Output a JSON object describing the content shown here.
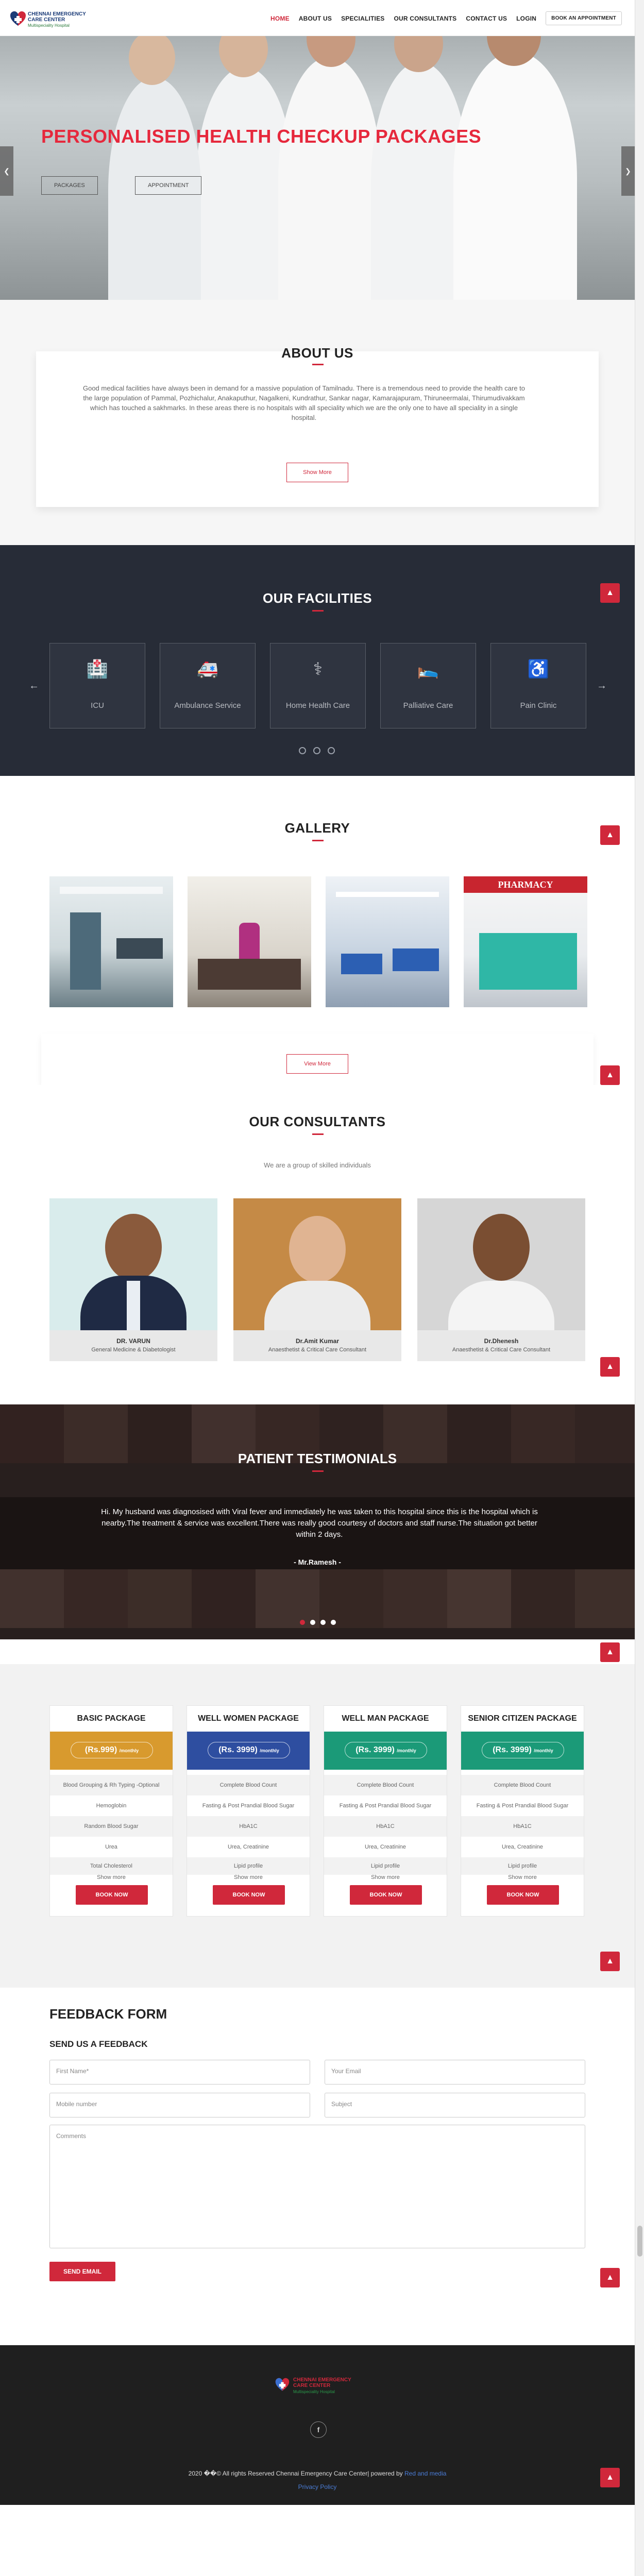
{
  "brand": {
    "name_line1": "CHENNAI EMERGENCY",
    "name_line2": "CARE CENTER",
    "tagline": "Multispeciality Hospital",
    "colors": {
      "accent": "#d0283b",
      "dark": "#272c37",
      "footer": "#1f1f1f"
    }
  },
  "nav": {
    "items": [
      {
        "label": "HOME",
        "active": true
      },
      {
        "label": "ABOUT US",
        "active": false
      },
      {
        "label": "SPECIALITIES",
        "active": false
      },
      {
        "label": "OUR CONSULTANTS",
        "active": false
      },
      {
        "label": "CONTACT US",
        "active": false
      },
      {
        "label": "LOGIN",
        "active": false
      }
    ],
    "appointment_label": "BOOK AN APPOINTMENT"
  },
  "hero": {
    "title": "PERSONALISED HEALTH CHECKUP PACKAGES",
    "buttons": [
      "PACKAGES",
      "APPOINTMENT"
    ],
    "prev_icon": "chevron-left-icon",
    "next_icon": "chevron-right-icon"
  },
  "about": {
    "title": "ABOUT US",
    "text": "Good medical facilities have always been in demand for a massive population of Tamilnadu. There is a tremendous need to provide the health care to the large population of Pammal, Pozhichalur, Anakaputhur, Nagalkeni, Kundrathur, Sankar nagar, Kamarajapuram, Thiruneermalai, Thirumudivakkam which has touched a sakhmarks. In these areas there is no hospitals with all speciality which we are the only one to have all speciality in a single hospital.",
    "button": "Show More"
  },
  "facilities": {
    "title": "OUR FACILITIES",
    "items": [
      {
        "label": "ICU",
        "icon": "hospital-building-icon"
      },
      {
        "label": "Ambulance Service",
        "icon": "ambulance-icon"
      },
      {
        "label": "Home Health Care",
        "icon": "nurse-icon"
      },
      {
        "label": "Palliative Care",
        "icon": "hospital-bed-icon"
      },
      {
        "label": "Pain Clinic",
        "icon": "wheelchair-icon"
      }
    ],
    "prev": "←",
    "next": "→"
  },
  "gallery": {
    "title": "GALLERY",
    "sign_text": "PHARMACY",
    "button": "View More"
  },
  "consultants": {
    "title": "OUR CONSULTANTS",
    "subtitle": "We are a group of skilled individuals",
    "people": [
      {
        "name": "DR. VARUN",
        "role": "General Medicine & Diabetologist"
      },
      {
        "name": "Dr.Amit Kumar",
        "role": "Anaesthetist & Critical Care Consultant"
      },
      {
        "name": "Dr.Dhenesh",
        "role": "Anaesthetist & Critical Care Consultant"
      }
    ]
  },
  "testimonials": {
    "title": "PATIENT TESTIMONIALS",
    "quote": "Hi. My husband was diagnosised with Viral fever and immediately he was taken to this hospital since this is the hospital which is nearby.The treatment & service was excellent.There was really good courtesy of doctors and staff nurse.The situation got better within 2 days.",
    "author": "- Mr.Ramesh -",
    "dots": 4,
    "active_dot": 0
  },
  "packages": {
    "items": [
      {
        "title": "BASIC PACKAGE",
        "price": "Rs.999",
        "per": "/monthly",
        "color": "#d89a2e",
        "features": [
          "Blood Grouping & Rh Typing -Optional",
          "Hemoglobin",
          "Random Blood Sugar",
          "Urea",
          "Total Cholesterol",
          "Show more"
        ]
      },
      {
        "title": "WELL WOMEN PACKAGE",
        "price": "Rs. 3999",
        "per": "/monthly",
        "color": "#2e4ea0",
        "features": [
          "Complete Blood Count",
          "Fasting & Post Prandial Blood Sugar",
          "HbA1C",
          "Urea, Creatinine",
          "Lipid profile",
          "Show more"
        ]
      },
      {
        "title": "WELL MAN PACKAGE",
        "price": "Rs. 3999",
        "per": "/monthly",
        "color": "#1b9a78",
        "features": [
          "Complete Blood Count",
          "Fasting & Post Prandial Blood Sugar",
          "HbA1C",
          "Urea, Creatinine",
          "Lipid profile",
          "Show more"
        ]
      },
      {
        "title": "SENIOR CITIZEN PACKAGE",
        "price": "Rs. 3999",
        "per": "/monthly",
        "color": "#1b9a78",
        "features": [
          "Complete Blood Count",
          "Fasting & Post Prandial Blood Sugar",
          "HbA1C",
          "Urea, Creatinine",
          "Lipid profile",
          "Show more"
        ]
      }
    ],
    "book_label": "BOOK NOW"
  },
  "feedback": {
    "title": "FEEDBACK FORM",
    "subtitle": "SEND US A FEEDBACK",
    "first_name": "First Name*",
    "email": "Your Email",
    "mobile": "Mobile number",
    "subject": "Subject",
    "comments": "Comments",
    "send": "SEND EMAIL"
  },
  "footer": {
    "facebook_icon": "facebook-icon",
    "copyright_pre": "2020 ��© All rights Reserved Chennai Emergency Care Center| powered by ",
    "powered_by": "Red and media",
    "policy": "Privacy Policy"
  },
  "scroll_top_icon": "arrow-up-icon"
}
